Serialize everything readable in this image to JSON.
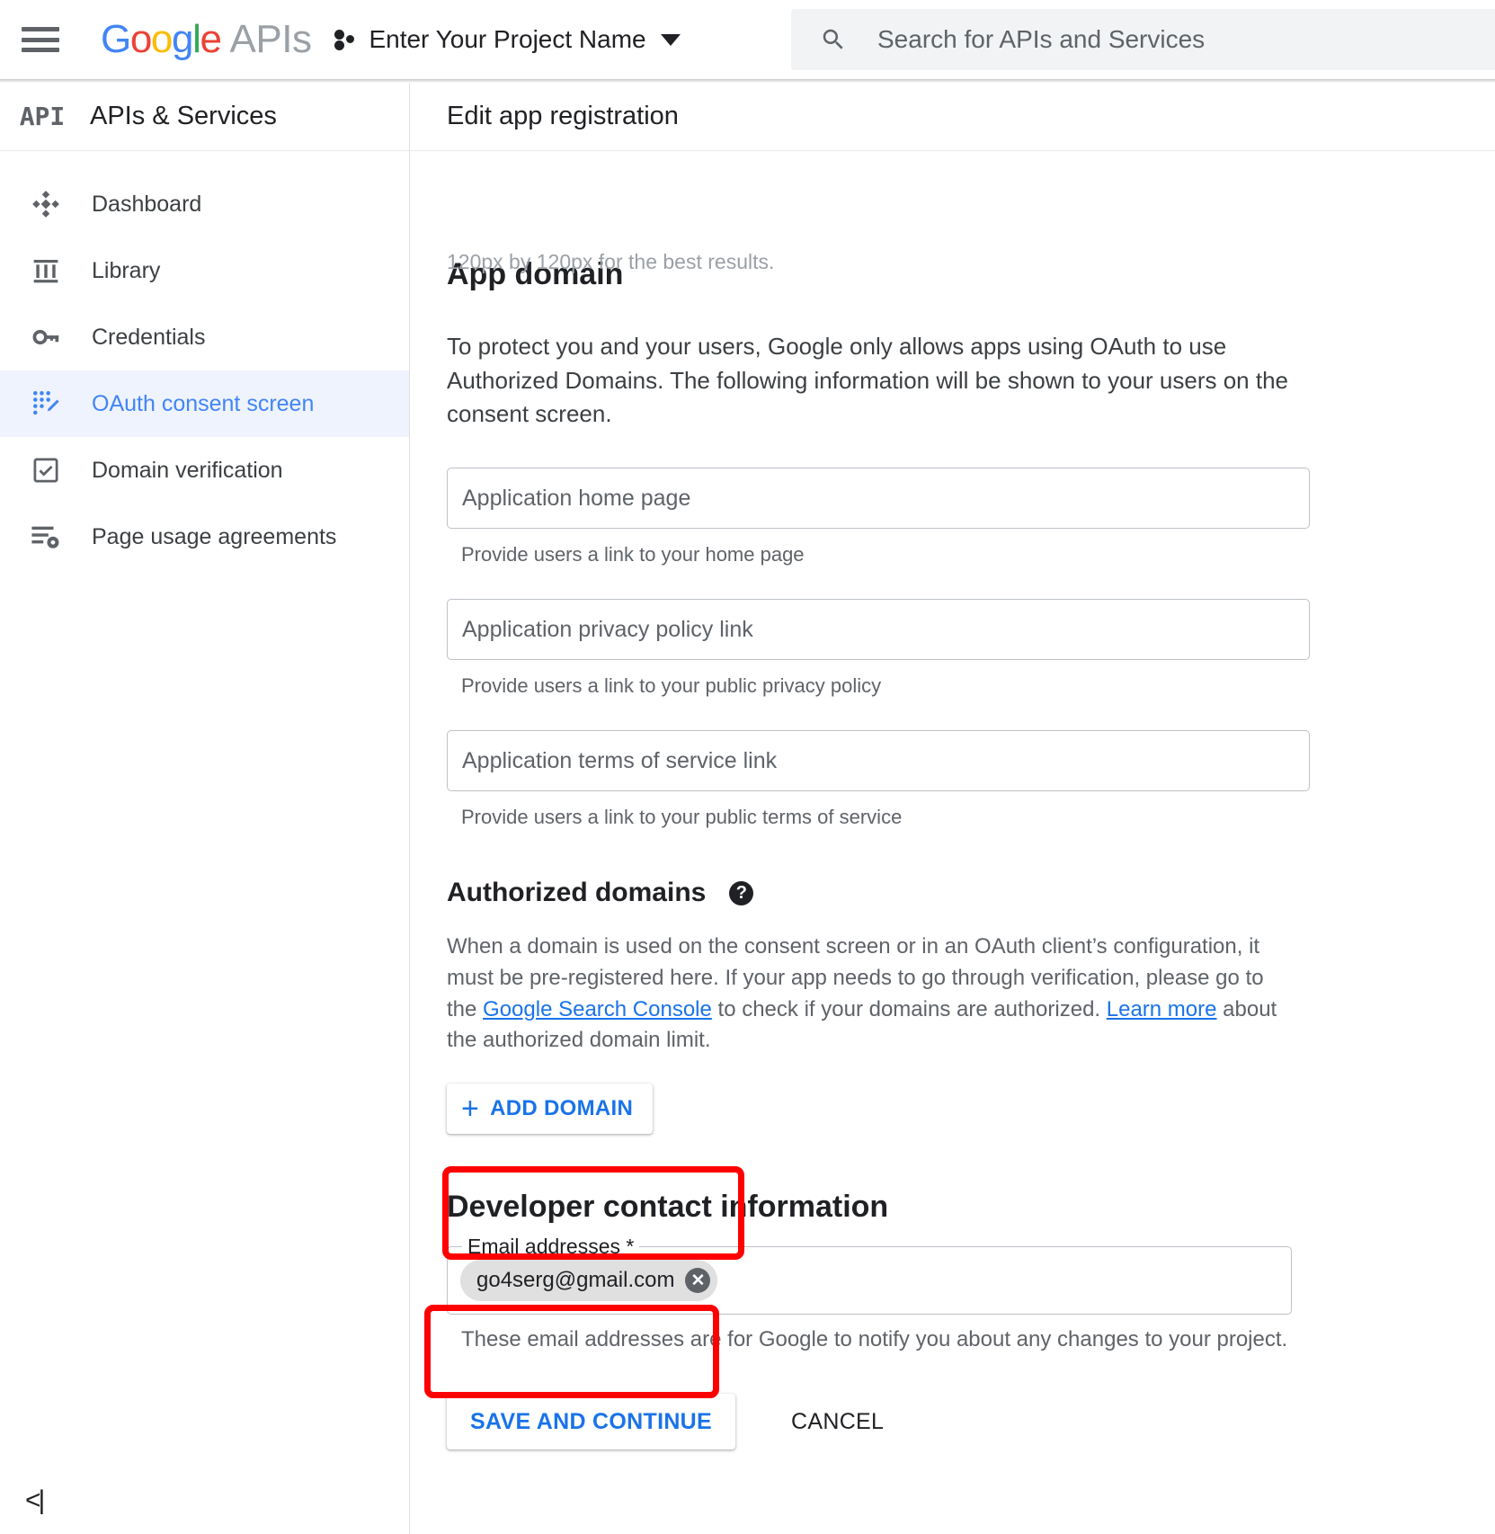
{
  "topbar": {
    "menu_icon": "hamburger-icon",
    "logo": {
      "g1": "G",
      "o1": "o",
      "o2": "o",
      "g2": "g",
      "l": "l",
      "e": "e",
      "suffix": "APIs"
    },
    "project_selector_label": "Enter Your Project Name",
    "project_caret_icon": "chevron-down-icon",
    "search": {
      "icon": "search-icon",
      "placeholder": "Search for APIs and Services",
      "value": ""
    }
  },
  "sidebar": {
    "badge": "API",
    "title": "APIs & Services",
    "collapse_label": "<|",
    "items": [
      {
        "label": "Dashboard",
        "icon": "dashboard-diamond-icon",
        "active": false
      },
      {
        "label": "Library",
        "icon": "library-icon",
        "active": false
      },
      {
        "label": "Credentials",
        "icon": "key-icon",
        "active": false
      },
      {
        "label": "OAuth consent screen",
        "icon": "oauth-consent-icon",
        "active": true
      },
      {
        "label": "Domain verification",
        "icon": "checkbox-icon",
        "active": false
      },
      {
        "label": "Page usage agreements",
        "icon": "list-gear-icon",
        "active": false
      }
    ]
  },
  "main": {
    "title": "Edit app registration",
    "clipped_top_text": "120px by 120px for the best results.",
    "app_domain": {
      "heading": "App domain",
      "description": "To protect you and your users, Google only allows apps using OAuth to use Authorized Domains. The following information will be shown to your users on the consent screen.",
      "fields": [
        {
          "placeholder": "Application home page",
          "value": "",
          "hint": "Provide users a link to your home page"
        },
        {
          "placeholder": "Application privacy policy link",
          "value": "",
          "hint": "Provide users a link to your public privacy policy"
        },
        {
          "placeholder": "Application terms of service link",
          "value": "",
          "hint": "Provide users a link to your public terms of service"
        }
      ]
    },
    "authorized_domains": {
      "heading": "Authorized domains",
      "help_icon": "help-question-icon",
      "text_part1": "When a domain is used on the consent screen or in an OAuth client’s configuration, it must be pre-registered here. If your app needs to go through verification, please go to the ",
      "link1": "Google Search Console",
      "text_part2": " to check if your domains are authorized. ",
      "link2": "Learn more",
      "text_part3": " about the authorized domain limit.",
      "add_domain_button": "ADD DOMAIN",
      "add_icon": "plus-icon"
    },
    "developer_contact": {
      "heading": "Developer contact information",
      "field_label": "Email addresses *",
      "chips": [
        {
          "text": "go4serg@gmail.com",
          "remove_icon": "close-circle-icon"
        }
      ],
      "hint": "These email addresses are for Google to notify you about any changes to your project."
    },
    "actions": {
      "save_label": "SAVE AND CONTINUE",
      "cancel_label": "CANCEL"
    }
  },
  "annotations": {
    "highlight_color": "#ff0000",
    "boxes": [
      "email-addresses-field",
      "save-and-continue-button"
    ]
  }
}
